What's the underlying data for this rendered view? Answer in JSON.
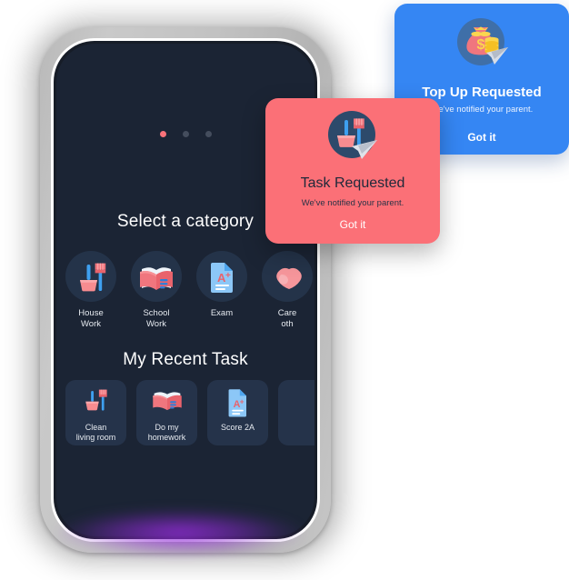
{
  "phone_screen": {
    "pager": {
      "total_dots": 3,
      "active_index": 0,
      "active_color": "#f9727a",
      "inactive_color": "#444d5d"
    },
    "category_section": {
      "title": "Select a category",
      "items": [
        {
          "label_line1": "House",
          "label_line2": "Work",
          "icon": "broom-dustpan-icon"
        },
        {
          "label_line1": "School",
          "label_line2": "Work",
          "icon": "open-book-icon"
        },
        {
          "label_line1": "Exam",
          "label_line2": "",
          "icon": "exam-paper-icon"
        },
        {
          "label_line1": "Care",
          "label_line2": "oth",
          "icon": "helping-hands-icon"
        }
      ]
    },
    "recent_section": {
      "title": "My Recent Task",
      "items": [
        {
          "label_line1": "Clean",
          "label_line2": "living room",
          "icon": "broom-dustpan-icon"
        },
        {
          "label_line1": "Do my",
          "label_line2": "homework",
          "icon": "open-book-icon"
        },
        {
          "label_line1": "Score 2A",
          "label_line2": "",
          "icon": "exam-paper-icon"
        },
        {
          "label_line1": "",
          "label_line2": "",
          "icon": "partial-icon"
        }
      ]
    }
  },
  "cards": {
    "top_up": {
      "title": "Top Up Requested",
      "subtitle": "We've notified your parent.",
      "button_label": "Got it",
      "icon": "money-bag-send-icon",
      "bg_color": "#3586f3"
    },
    "task": {
      "title": "Task Requested",
      "subtitle": "We've notified your parent.",
      "button_label": "Got it",
      "icon": "broom-dustpan-send-icon",
      "bg_color": "#fb7077"
    }
  }
}
